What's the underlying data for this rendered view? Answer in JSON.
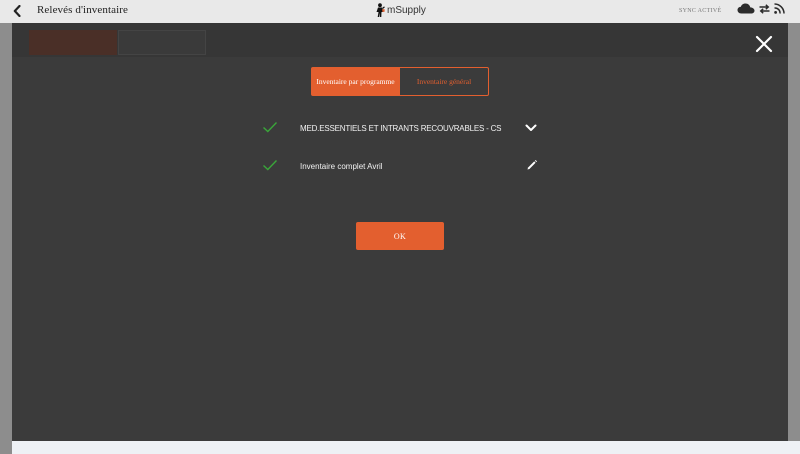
{
  "header": {
    "title": "Relevés d'inventaire",
    "brand_name": "mSupply",
    "sync_label": "SYNC ACTIVÉ",
    "back_icon": "chevron-left-icon",
    "icons": [
      "cloud-icon",
      "sync-arrows-icon",
      "rss-icon"
    ]
  },
  "modal": {
    "segments": [
      {
        "label": "Inventaire par programme",
        "active": true
      },
      {
        "label": "Inventaire général",
        "active": false
      }
    ],
    "rows": [
      {
        "label": "MED.ESSENTIELS ET INTRANTS RECOUVRABLES - CS",
        "status": "checked",
        "action_icon": "chevron-down-icon"
      },
      {
        "label": "Inventaire complet Avril",
        "status": "checked",
        "action_icon": "pencil-icon"
      }
    ],
    "ok_label": "OK",
    "close_icon": "close-icon"
  },
  "colors": {
    "accent": "#e35f2f",
    "check": "#3aa63a",
    "modal_bg": "#3b3b3b",
    "header_bg": "#e9e9e9"
  }
}
